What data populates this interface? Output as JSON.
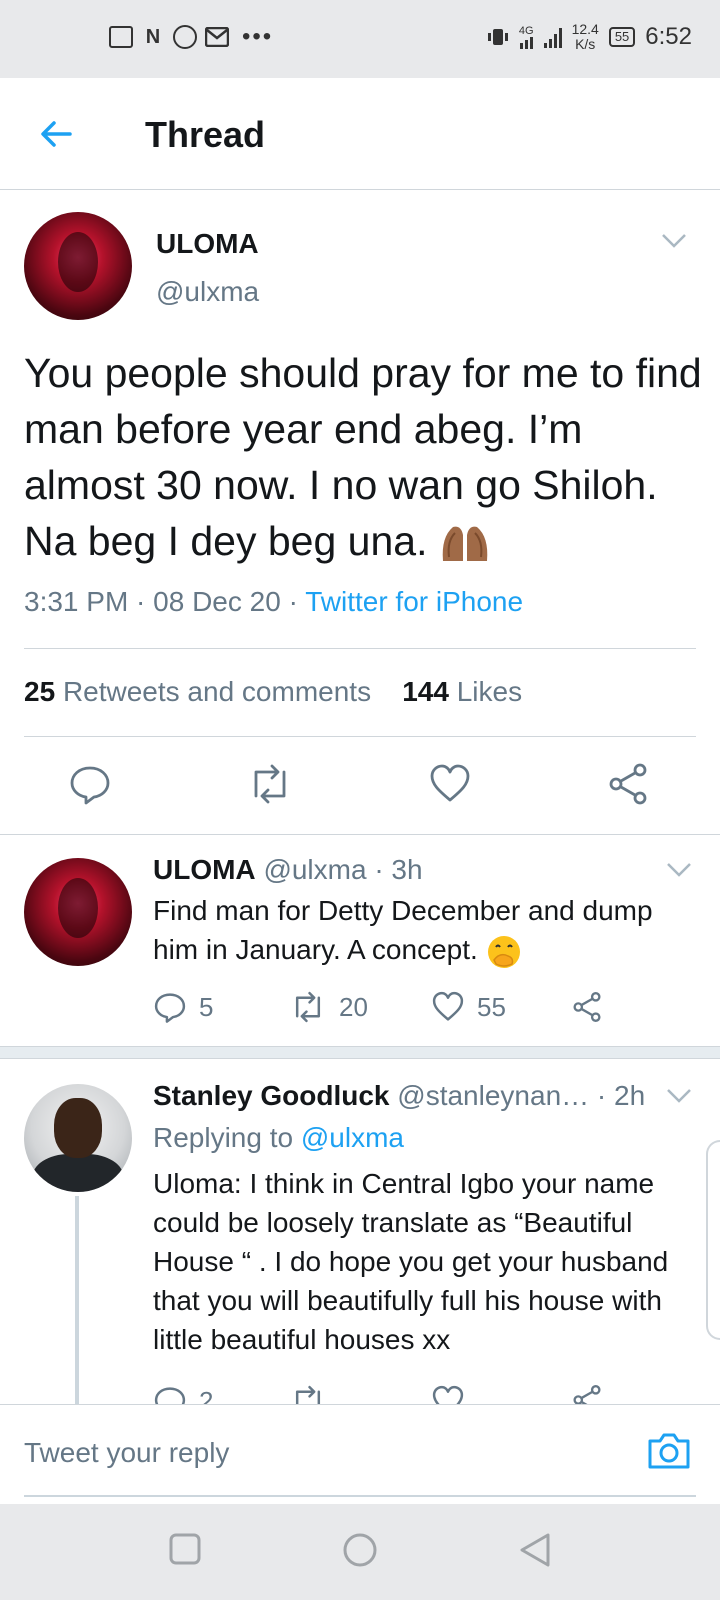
{
  "status_bar": {
    "network": "4G",
    "speed_value": "12.4",
    "speed_unit": "K/s",
    "battery": "55",
    "time": "6:52"
  },
  "header": {
    "title": "Thread"
  },
  "main_tweet": {
    "name": "ULOMA",
    "handle": "@ulxma",
    "text": "You people should pray for me to find man before year end abeg. I’m almost 30 now. I no wan go Shiloh. Na beg I dey beg una.",
    "emoji": "praying-hands",
    "time": "3:31 PM · 08 Dec 20 · ",
    "source": "Twitter for iPhone",
    "retweets_count": "25",
    "retweets_label": "Retweets and comments",
    "likes_count": "144",
    "likes_label": "Likes"
  },
  "replies": [
    {
      "name": "ULOMA",
      "meta": "@ulxma · 3h",
      "text": "Find man for Detty December and dump him in January. A concept.",
      "emoji": "face-with-hand-over-mouth",
      "comments": "5",
      "retweets": "20",
      "likes": "55"
    },
    {
      "name": "Stanley Goodluck",
      "meta": "@stanleynan… · 2h",
      "replying_prefix": "Replying to ",
      "replying_handle": "@ulxma",
      "text": "Uloma: I think in Central Igbo your name could be loosely translate as “Beautiful House “ . I do hope you get your husband that you will beautifully full his house with little beautiful houses xx",
      "comments": "2"
    }
  ],
  "reply_bar": {
    "placeholder": "Tweet your reply"
  },
  "colors": {
    "accent": "#1da1f2",
    "secondary_text": "#657786",
    "divider": "#d0d6db"
  }
}
